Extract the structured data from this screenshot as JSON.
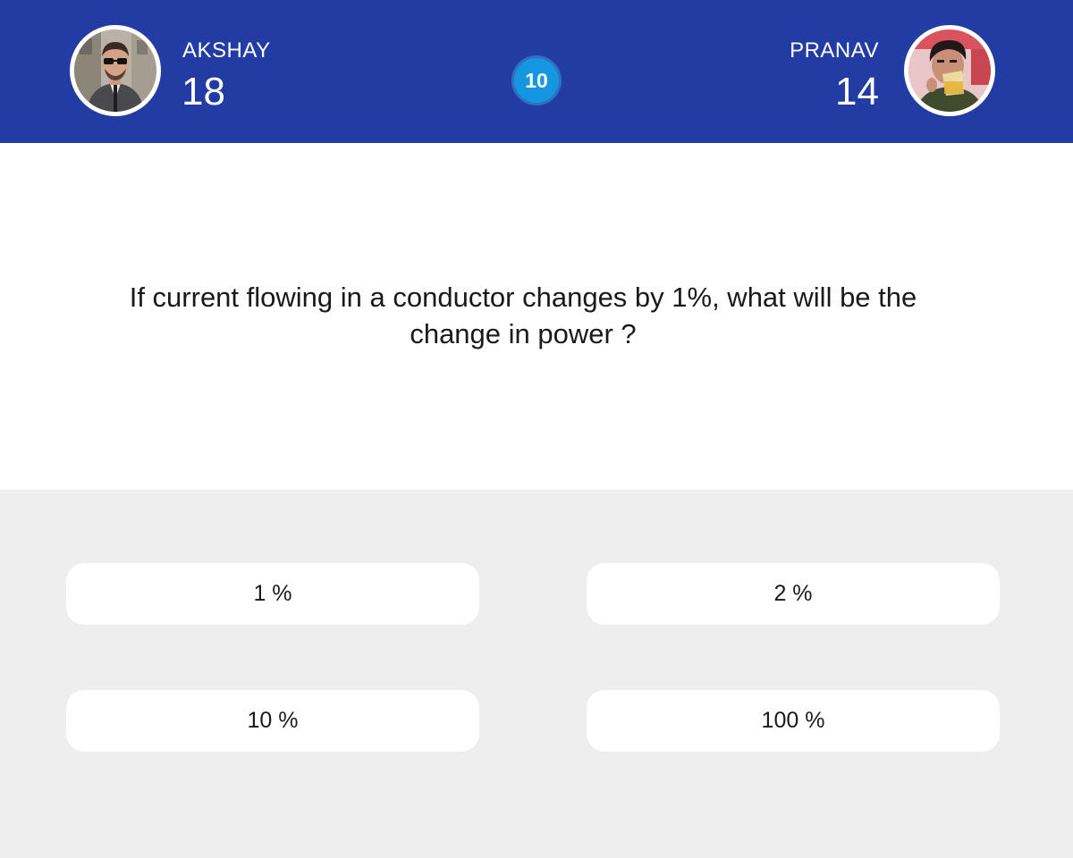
{
  "header": {
    "background_color": "#233ca3",
    "timer": "10",
    "timer_color": "#1597df",
    "player_left": {
      "name": "AKSHAY",
      "score": "18",
      "avatar": "player-photo"
    },
    "player_right": {
      "name": "PRANAV",
      "score": "14",
      "avatar": "player-photo"
    }
  },
  "question": {
    "text": "If current flowing in a conductor changes by 1%, what will be the change in power ?"
  },
  "answers": {
    "options": [
      "1 %",
      "2 %",
      "10 %",
      "100 %"
    ]
  }
}
